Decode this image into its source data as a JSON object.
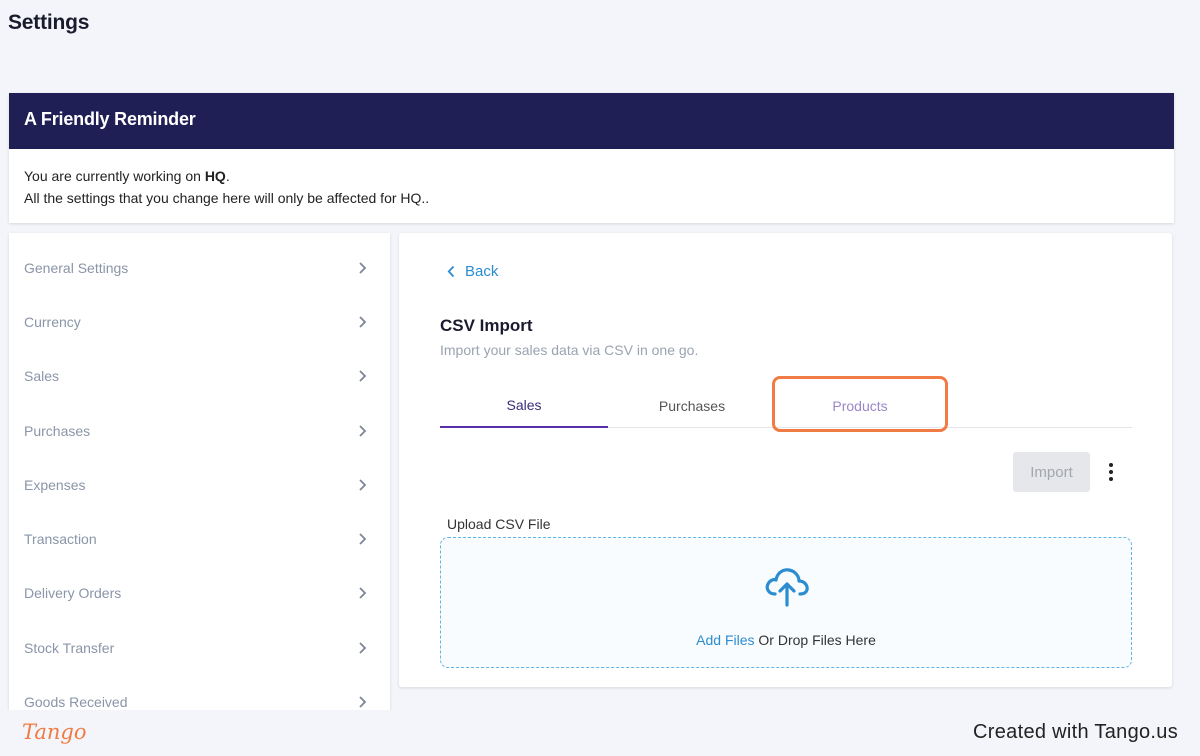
{
  "page": {
    "title": "Settings"
  },
  "reminder": {
    "heading": "A Friendly Reminder",
    "line1_prefix": "You are currently working on ",
    "line1_bold": "HQ",
    "line1_suffix": ".",
    "line2": "All the settings that you change here will only be affected for HQ.."
  },
  "sidebar": {
    "items": [
      {
        "label": "General Settings"
      },
      {
        "label": "Currency"
      },
      {
        "label": "Sales"
      },
      {
        "label": "Purchases"
      },
      {
        "label": "Expenses"
      },
      {
        "label": "Transaction"
      },
      {
        "label": "Delivery Orders"
      },
      {
        "label": "Stock Transfer"
      },
      {
        "label": "Goods Received"
      }
    ]
  },
  "main": {
    "back_label": "Back",
    "title": "CSV Import",
    "subtitle": "Import your sales data via CSV in one go.",
    "tabs": [
      {
        "label": "Sales",
        "active": true
      },
      {
        "label": "Purchases",
        "active": false
      },
      {
        "label": "Products",
        "active": false
      }
    ],
    "import_label": "Import",
    "upload_label": "Upload CSV File",
    "drop_link": "Add Files",
    "drop_text": " Or Drop Files Here"
  },
  "footer": {
    "logo_text": "Tango",
    "created": "Created with Tango.us"
  },
  "colors": {
    "header_navy": "#201f55",
    "link_blue": "#2b8ccf",
    "tab_active": "#5b2fa8",
    "highlight_orange": "#f07b45"
  }
}
